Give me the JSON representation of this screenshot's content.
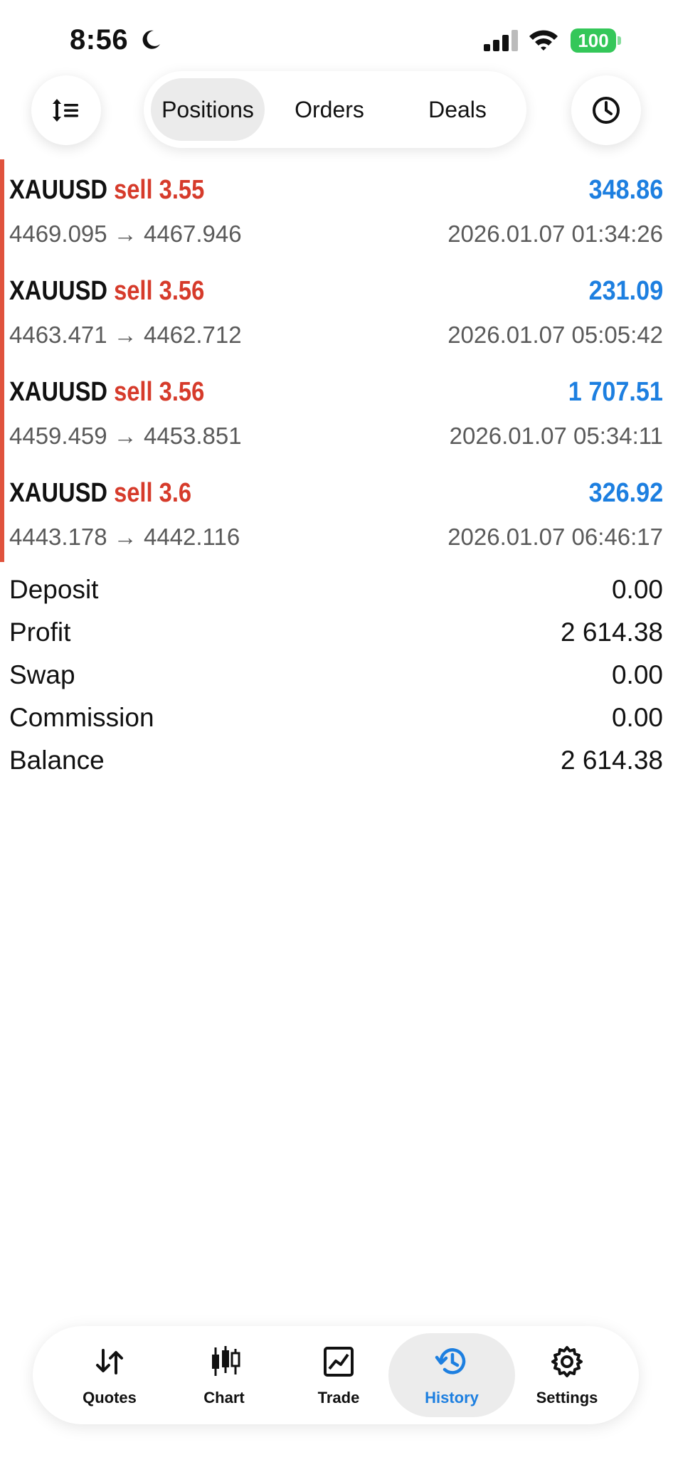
{
  "status_bar": {
    "time": "8:56",
    "battery": "100"
  },
  "tabs": [
    {
      "label": "Positions",
      "active": true
    },
    {
      "label": "Orders",
      "active": false
    },
    {
      "label": "Deals",
      "active": false
    }
  ],
  "positions": [
    {
      "symbol": "XAUUSD",
      "side": "sell 3.55",
      "profit": "348.86",
      "prices": "4469.095 → 4467.946",
      "datetime": "2026.01.07 01:34:26"
    },
    {
      "symbol": "XAUUSD",
      "side": "sell 3.56",
      "profit": "231.09",
      "prices": "4463.471 → 4462.712",
      "datetime": "2026.01.07 05:05:42"
    },
    {
      "symbol": "XAUUSD",
      "side": "sell 3.56",
      "profit": "1 707.51",
      "prices": "4459.459 → 4453.851",
      "datetime": "2026.01.07 05:34:11"
    },
    {
      "symbol": "XAUUSD",
      "side": "sell 3.6",
      "profit": "326.92",
      "prices": "4443.178 → 4442.116",
      "datetime": "2026.01.07 06:46:17"
    }
  ],
  "summary": [
    {
      "label": "Deposit",
      "value": "0.00"
    },
    {
      "label": "Profit",
      "value": "2 614.38"
    },
    {
      "label": "Swap",
      "value": "0.00"
    },
    {
      "label": "Commission",
      "value": "0.00"
    },
    {
      "label": "Balance",
      "value": "2 614.38"
    }
  ],
  "nav": [
    {
      "label": "Quotes",
      "icon": "quotes-icon",
      "active": false
    },
    {
      "label": "Chart",
      "icon": "chart-icon",
      "active": false
    },
    {
      "label": "Trade",
      "icon": "trade-icon",
      "active": false
    },
    {
      "label": "History",
      "icon": "history-icon",
      "active": true
    },
    {
      "label": "Settings",
      "icon": "settings-icon",
      "active": false
    }
  ],
  "colors": {
    "sell": "#d63b2b",
    "profit": "#1d7fe0",
    "active_nav": "#1d7fe0",
    "battery": "#34c759"
  }
}
